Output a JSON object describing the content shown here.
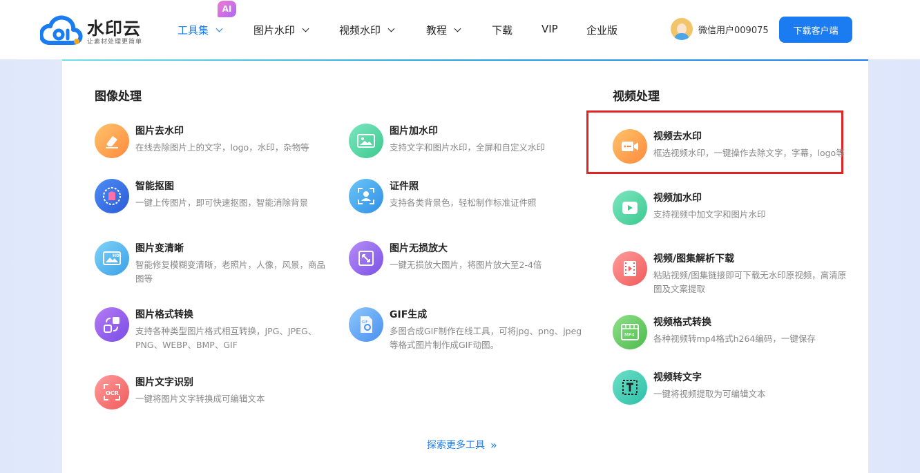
{
  "brand": {
    "name": "水印云",
    "slogan": "让素材处理更简单",
    "color": "#1a7cf0"
  },
  "nav": {
    "items": [
      {
        "label": "工具集",
        "has_dropdown": true,
        "active": true
      },
      {
        "label": "图片水印",
        "has_dropdown": true
      },
      {
        "label": "视频水印",
        "has_dropdown": true
      },
      {
        "label": "教程",
        "has_dropdown": true
      },
      {
        "label": "下载"
      },
      {
        "label": "VIP"
      },
      {
        "label": "企业版"
      }
    ],
    "ai_badge": "AI"
  },
  "user": {
    "name": "微信用户009075"
  },
  "download_button": "下载客户端",
  "image_section": {
    "title": "图像处理",
    "tools": [
      {
        "name": "图片去水印",
        "desc": "在线去除图片上的文字，logo，水印，杂物等",
        "icon": "eraser-icon"
      },
      {
        "name": "图片加水印",
        "desc": "支持文字和图片水印，全屏和自定义水印",
        "icon": "image-add-icon"
      },
      {
        "name": "智能抠图",
        "desc": "一键上传图片，即可快速抠图，智能消除背景",
        "icon": "cutout-icon"
      },
      {
        "name": "证件照",
        "desc": "支持各类背景色，轻松制作标准证件照",
        "icon": "id-photo-icon"
      },
      {
        "name": "图片变清晰",
        "desc": "智能修复模糊变清晰，老照片，人像，风景，商品图等",
        "icon": "hd-image-icon"
      },
      {
        "name": "图片无损放大",
        "desc": "一键无损放大图片，将图片放大至2-4倍",
        "icon": "enlarge-icon"
      },
      {
        "name": "图片格式转换",
        "desc": "支持各种类型图片格式相互转换，JPG、JPEG、PNG、WEBP、BMP、GIF",
        "icon": "convert-icon"
      },
      {
        "name": "GIF生成",
        "desc": "多图合成GIF制作在线工具，可将jpg、png、jpeg等格式图片制作成GIF动图。",
        "icon": "gif-icon"
      },
      {
        "name": "图片文字识别",
        "desc": "一键将图片文字转换成可编辑文本",
        "icon": "ocr-icon"
      }
    ]
  },
  "video_section": {
    "title": "视频处理",
    "tools": [
      {
        "name": "视频去水印",
        "desc": "框选视频水印，一键操作去除文字，字幕，logo等",
        "icon": "video-camera-icon"
      },
      {
        "name": "视频加水印",
        "desc": "支持视频中加文字和图片水印",
        "icon": "video-play-icon"
      },
      {
        "name": "视频/图集解析下载",
        "desc": "粘贴视频/图集链接即可下载无水印原视频，高清原图及文案提取",
        "icon": "film-icon"
      },
      {
        "name": "视频格式转换",
        "desc": "各种视频转mp4格式h264编码，一键保存",
        "icon": "mp4-icon"
      },
      {
        "name": "视频转文字",
        "desc": "一键将视频提取为可编辑文本",
        "icon": "text-icon"
      }
    ]
  },
  "explore_more": "探索更多工具",
  "colors": {
    "accent": "#1a7cf0",
    "highlight": "#e02424"
  }
}
